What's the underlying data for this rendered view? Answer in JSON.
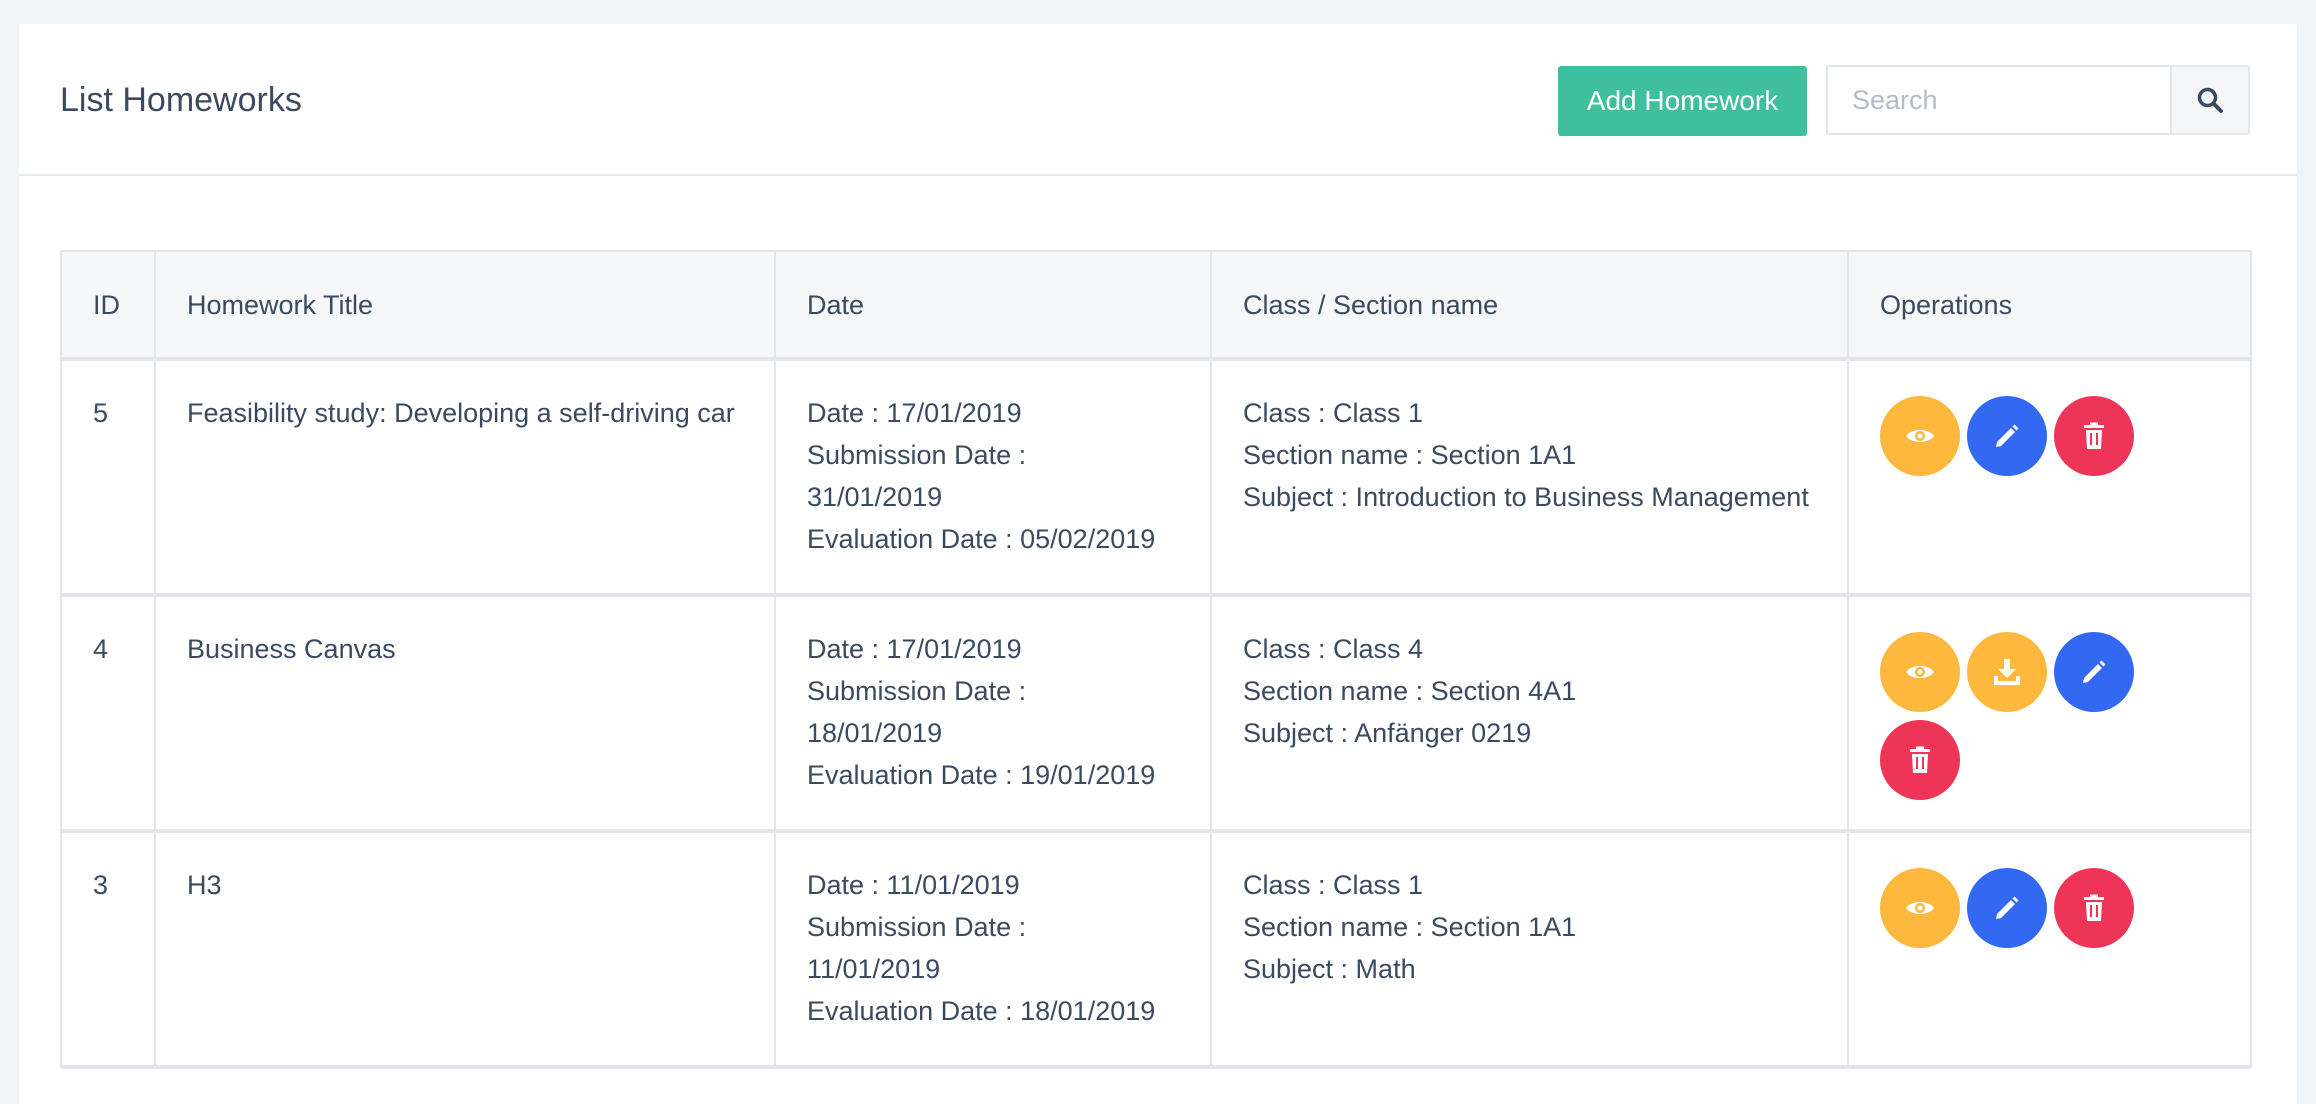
{
  "header": {
    "title": "List Homeworks",
    "add_button": "Add Homework",
    "search_placeholder": "Search",
    "search_icon": "search-icon"
  },
  "table": {
    "columns": [
      "ID",
      "Homework Title",
      "Date",
      "Class / Section name",
      "Operations"
    ],
    "rows": [
      {
        "id": "5",
        "title": "Feasibility study: Developing a self-driving car",
        "date": "Date : 17/01/2019",
        "submission_label": "Submission Date :",
        "submission_value": "31/01/2019",
        "evaluation": "Evaluation Date : 05/02/2019",
        "class": "Class : Class 1",
        "section": "Section name : Section 1A1",
        "subject": "Subject : Introduction to Business Management",
        "operations": [
          "view",
          "edit",
          "delete"
        ]
      },
      {
        "id": "4",
        "title": "Business Canvas",
        "date": "Date : 17/01/2019",
        "submission_label": "Submission Date :",
        "submission_value": "18/01/2019",
        "evaluation": "Evaluation Date : 19/01/2019",
        "class": "Class : Class 4",
        "section": "Section name : Section 4A1",
        "subject": "Subject : Anfänger 0219",
        "operations": [
          "view",
          "download",
          "edit",
          "delete"
        ]
      },
      {
        "id": "3",
        "title": "H3",
        "date": "Date : 11/01/2019",
        "submission_label": "Submission Date :",
        "submission_value": "11/01/2019",
        "evaluation": "Evaluation Date : 18/01/2019",
        "class": "Class : Class 1",
        "section": "Section name : Section 1A1",
        "subject": "Subject : Math",
        "operations": [
          "view",
          "edit",
          "delete"
        ]
      }
    ]
  },
  "colors": {
    "accent_green": "#3fbf9e",
    "view_yellow": "#fdb83d",
    "edit_blue": "#3368f3",
    "delete_red": "#ef3557"
  }
}
